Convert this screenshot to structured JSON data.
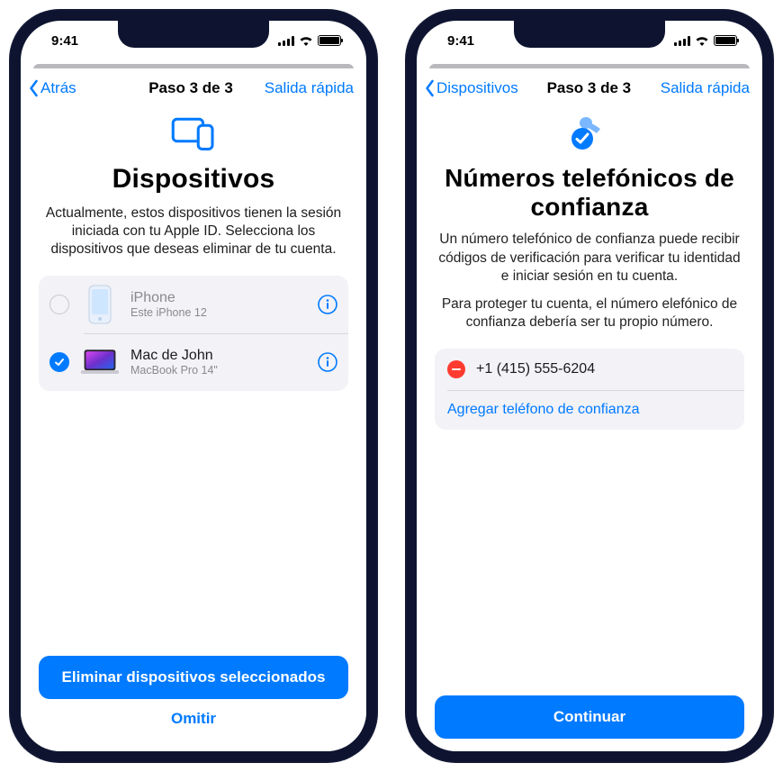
{
  "status": {
    "time": "9:41"
  },
  "phone1": {
    "nav": {
      "back": "Atrás",
      "step": "Paso 3 de 3",
      "quick": "Salida rápida"
    },
    "title": "Dispositivos",
    "description": "Actualmente, estos dispositivos tienen la sesión iniciada con tu Apple ID. Selecciona los dispositivos que deseas eliminar de tu cuenta.",
    "devices": [
      {
        "name": "iPhone",
        "subtitle": "Este iPhone 12",
        "selected": false
      },
      {
        "name": "Mac de John",
        "subtitle": "MacBook Pro 14\"",
        "selected": true
      }
    ],
    "primary_button": "Eliminar dispositivos seleccionados",
    "secondary_button": "Omitir"
  },
  "phone2": {
    "nav": {
      "back": "Dispositivos",
      "step": "Paso 3 de 3",
      "quick": "Salida rápida"
    },
    "title": "Números telefónicos de confianza",
    "description1": "Un número telefónico de confianza puede recibir códigos de verificación para verificar tu identidad e iniciar sesión en tu cuenta.",
    "description2": "Para proteger tu cuenta, el número elefónico de confianza debería ser tu propio número.",
    "numbers": [
      {
        "value": "+1 (415) 555-6204"
      }
    ],
    "add_label": "Agregar teléfono de confianza",
    "primary_button": "Continuar"
  }
}
